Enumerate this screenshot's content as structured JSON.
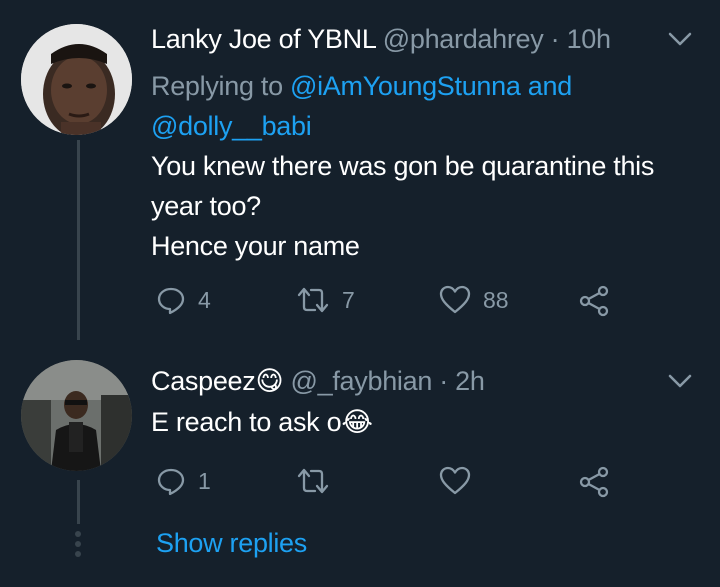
{
  "tweet1": {
    "name": "Lanky Joe of YBNL",
    "handle": "@phardahrey",
    "sep": " · ",
    "time": "10h",
    "replying_prefix": "Replying to ",
    "replying_user1": "@iAmYoungStunna",
    "replying_and": " and",
    "replying_user2": "@dolly__babi",
    "text_line1": "You knew there was gon be quarantine this",
    "text_line2": "year too?",
    "text_line3": "Hence your name",
    "replies": "4",
    "retweets": "7",
    "likes": "88"
  },
  "tweet2": {
    "name": "Caspeez",
    "name_emoji": "😋",
    "handle": "@_faybhian",
    "sep": " · ",
    "time": "2h",
    "text": "E reach to ask o",
    "text_emoji": "😂",
    "replies": "1"
  },
  "show_replies_label": "Show replies",
  "colors": {
    "background": "#15202b",
    "accent": "#1da1f2",
    "muted": "#8899a6",
    "thread": "#38444d"
  },
  "icons": [
    "chevron-down-icon",
    "reply-icon",
    "retweet-icon",
    "like-icon",
    "share-icon"
  ]
}
